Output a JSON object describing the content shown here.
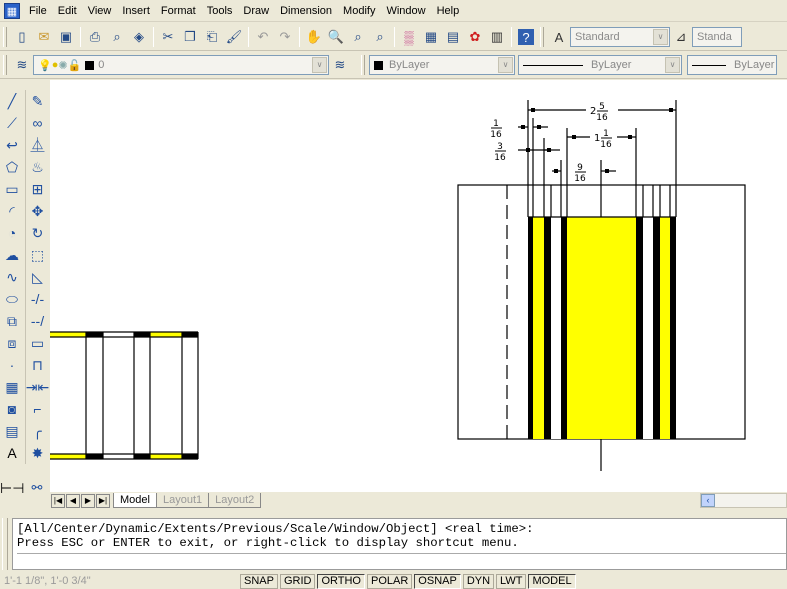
{
  "menubar": {
    "items": [
      "File",
      "Edit",
      "View",
      "Insert",
      "Format",
      "Tools",
      "Draw",
      "Dimension",
      "Modify",
      "Window",
      "Help"
    ]
  },
  "standard_toolbar": {
    "icons": [
      "new-icon",
      "open-icon",
      "save-icon",
      "plot-icon",
      "plot-preview-icon",
      "publish-icon",
      "cut-icon",
      "copy-icon",
      "paste-icon",
      "match-properties-icon",
      "undo-icon",
      "redo-icon",
      "pan-icon",
      "zoom-realtime-icon",
      "zoom-window-icon",
      "zoom-previous-icon",
      "properties-icon",
      "design-center-icon",
      "tool-palettes-icon",
      "markup-icon",
      "calculator-icon",
      "help-icon"
    ],
    "text_style": "Standard",
    "dim_style": "Standa"
  },
  "layers_toolbar": {
    "layer_name": "0"
  },
  "properties_toolbar": {
    "color": "ByLayer",
    "linetype": "ByLayer",
    "lineweight": "ByLayer"
  },
  "draw_toolbar": {
    "icons": [
      {
        "name": "line-icon",
        "g": "╱"
      },
      {
        "name": "construction-line-icon",
        "g": "⟋"
      },
      {
        "name": "polyline-icon",
        "g": "↩"
      },
      {
        "name": "polygon-icon",
        "g": "⬠"
      },
      {
        "name": "rectangle-icon",
        "g": "▭"
      },
      {
        "name": "arc-icon",
        "g": "◜"
      },
      {
        "name": "circle-icon",
        "g": "◔"
      },
      {
        "name": "revision-cloud-icon",
        "g": "☁"
      },
      {
        "name": "spline-icon",
        "g": "∿"
      },
      {
        "name": "ellipse-icon",
        "g": "⬭"
      },
      {
        "name": "insert-block-icon",
        "g": "⧉"
      },
      {
        "name": "make-block-icon",
        "g": "⧈"
      },
      {
        "name": "point-icon",
        "g": "·"
      },
      {
        "name": "hatch-icon",
        "g": "▦"
      },
      {
        "name": "region-icon",
        "g": "◙"
      },
      {
        "name": "table-icon",
        "g": "▤"
      },
      {
        "name": "multiline-text-icon",
        "g": "A"
      }
    ]
  },
  "modify_toolbar": {
    "icons": [
      {
        "name": "erase-icon",
        "g": "✎"
      },
      {
        "name": "copy-object-icon",
        "g": "∞"
      },
      {
        "name": "mirror-icon",
        "g": "⏅"
      },
      {
        "name": "offset-icon",
        "g": "♨"
      },
      {
        "name": "array-icon",
        "g": "⊞"
      },
      {
        "name": "move-icon",
        "g": "✥"
      },
      {
        "name": "rotate-icon",
        "g": "↻"
      },
      {
        "name": "scale-icon",
        "g": "⬚"
      },
      {
        "name": "stretch-icon",
        "g": "◺"
      },
      {
        "name": "trim-icon",
        "g": "-/-"
      },
      {
        "name": "extend-icon",
        "g": "--/"
      },
      {
        "name": "break-at-point-icon",
        "g": "▭"
      },
      {
        "name": "break-icon",
        "g": "⊓"
      },
      {
        "name": "join-icon",
        "g": "⇥⇤"
      },
      {
        "name": "chamfer-icon",
        "g": "⌐"
      },
      {
        "name": "fillet-icon",
        "g": "╭"
      },
      {
        "name": "explode-icon",
        "g": "✸"
      }
    ]
  },
  "dimensions": {
    "overall": {
      "whole": "2",
      "num": "5",
      "den": "16"
    },
    "d1": {
      "num": "1",
      "den": "16"
    },
    "d2": {
      "num": "3",
      "den": "16"
    },
    "d3": {
      "whole": "1",
      "num": "1",
      "den": "16"
    },
    "d4": {
      "num": "9",
      "den": "16"
    }
  },
  "colors": {
    "yellow": "#ffff00",
    "black": "#000000",
    "canvas": "#ffffff"
  },
  "tabs": {
    "items": [
      "Model",
      "Layout1",
      "Layout2"
    ],
    "active": "Model"
  },
  "command": {
    "line1": "[All/Center/Dynamic/Extents/Previous/Scale/Window/Object] <real time>:",
    "line2": "Press ESC or ENTER to exit, or right-click to display shortcut menu.",
    "input": ""
  },
  "status": {
    "coords": "1'-1 1/8\", 1'-0 3/4\"",
    "toggles": [
      {
        "label": "SNAP",
        "on": false
      },
      {
        "label": "GRID",
        "on": false
      },
      {
        "label": "ORTHO",
        "on": true
      },
      {
        "label": "POLAR",
        "on": false
      },
      {
        "label": "OSNAP",
        "on": true
      },
      {
        "label": "DYN",
        "on": false
      },
      {
        "label": "LWT",
        "on": false
      },
      {
        "label": "MODEL",
        "on": true
      }
    ]
  }
}
